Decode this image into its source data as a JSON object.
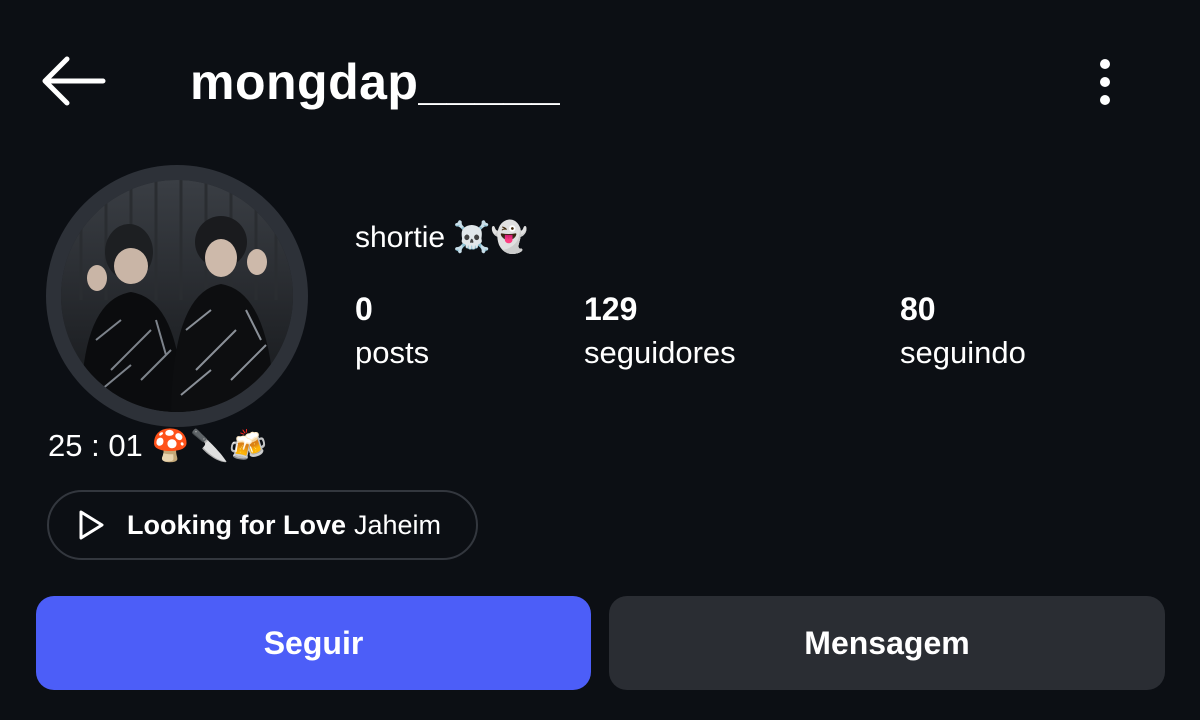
{
  "header": {
    "username": "mongdap_____"
  },
  "profile": {
    "display_name": "shortie ☠️👻",
    "bio": "25 : 01 🍄🔪🍻"
  },
  "stats": {
    "posts": {
      "count": "0",
      "label": "posts"
    },
    "followers": {
      "count": "129",
      "label": "seguidores"
    },
    "following": {
      "count": "80",
      "label": "seguindo"
    }
  },
  "music": {
    "title": "Looking for Love",
    "artist": "Jaheim"
  },
  "actions": {
    "follow_label": "Seguir",
    "message_label": "Mensagem"
  },
  "colors": {
    "background": "#0c0f14",
    "follow_button": "#4c5ef8",
    "message_button": "#2a2d33",
    "avatar_ring": "#2d3138"
  },
  "icons": {
    "back": "arrow-left-icon",
    "more": "more-vertical-icon",
    "play": "play-icon"
  }
}
